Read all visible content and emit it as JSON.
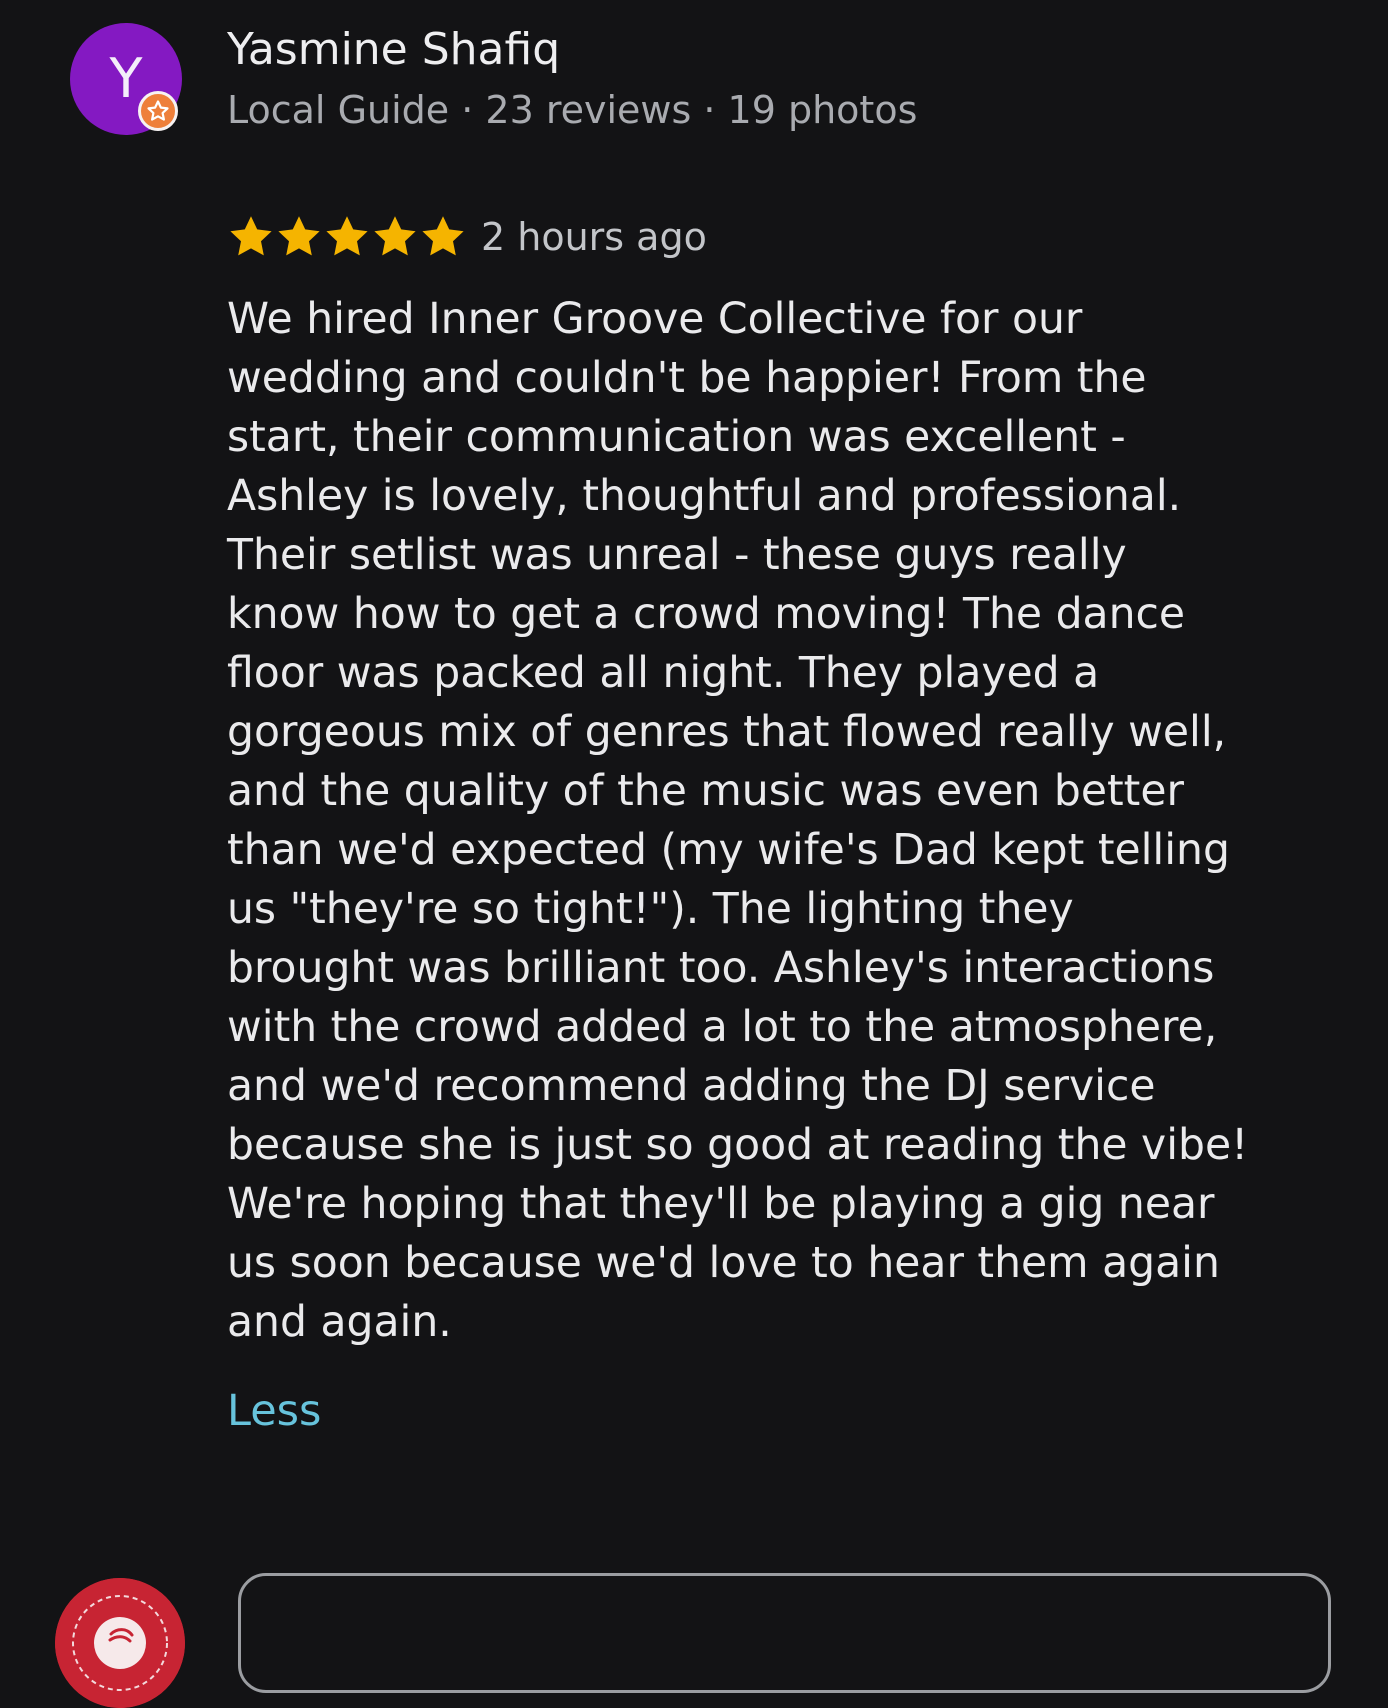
{
  "reviewer": {
    "initial": "Y",
    "name": "Yasmine Shafiq",
    "meta": "Local Guide · 23 reviews · 19 photos",
    "avatar_color": "#8419c2",
    "badge_icon": "local-guide-star-icon",
    "badge_color": "#ee7f3a"
  },
  "rating": {
    "stars": 5,
    "max_stars": 5,
    "star_icon": "star-icon",
    "star_color": "#f5b400",
    "time_ago": "2 hours ago"
  },
  "review": {
    "lines": [
      "We hired Inner Groove Collective for our",
      "wedding and couldn't be happier! From the",
      "start, their communication was excellent -",
      "Ashley is lovely, thoughtful and professional.",
      "Their setlist was unreal - these guys really",
      "know how to get a crowd moving! The dance",
      "floor was packed all night. They played a",
      "gorgeous mix of genres that flowed really well,",
      "and the quality of the music was even better",
      "than we'd expected (my wife's Dad kept telling",
      "us \"they're so tight!\"). The lighting they",
      "brought was brilliant too. Ashley's interactions",
      "with the crowd added a lot to the atmosphere,",
      "and we'd recommend adding the DJ service",
      "because she is just so good at reading the vibe!",
      "We're hoping that they'll be playing a gig near",
      "us soon because we'd love to hear them again",
      "and again."
    ],
    "collapse_label": "Less",
    "link_color": "#67c3dc"
  },
  "owner_reply": {
    "logo_icon": "inner-groove-logo-icon",
    "logo_color": "#c72433"
  },
  "theme": {
    "background": "#131315",
    "text": "#eaeaec",
    "muted_text": "#a9abb0"
  }
}
